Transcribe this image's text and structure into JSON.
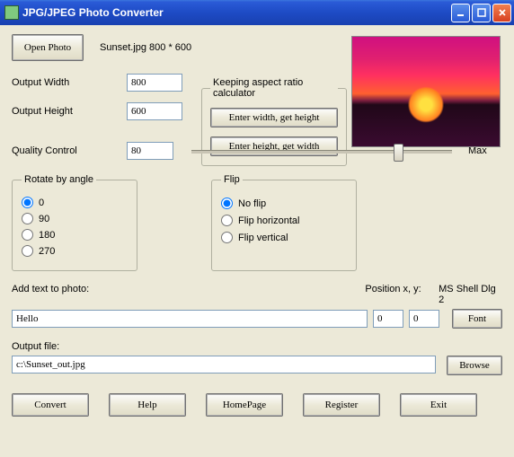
{
  "window": {
    "title": "JPG/JPEG Photo Converter"
  },
  "open_photo": {
    "button": "Open Photo",
    "filename": "Sunset.jpg 800 * 600"
  },
  "dimensions": {
    "width_label": "Output Width",
    "width_value": "800",
    "height_label": "Output Height",
    "height_value": "600"
  },
  "aspect": {
    "legend": "Keeping aspect ratio calculator",
    "btn_width": "Enter width, get height",
    "btn_height": "Enter height, get width"
  },
  "quality": {
    "label": "Quality Control",
    "value": "80",
    "max": "Max"
  },
  "rotate": {
    "legend": "Rotate by angle",
    "options": [
      "0",
      "90",
      "180",
      "270"
    ],
    "selected": "0"
  },
  "flip": {
    "legend": "Flip",
    "options": [
      "No flip",
      "Flip horizontal",
      "Flip vertical"
    ],
    "selected": "No flip"
  },
  "addtext": {
    "label": "Add text to photo:",
    "value": "Hello",
    "pos_label": "Position x, y:",
    "x": "0",
    "y": "0",
    "font_name": "MS Shell Dlg 2",
    "font_btn": "Font"
  },
  "output": {
    "label": "Output file:",
    "value": "c:\\Sunset_out.jpg",
    "browse": "Browse"
  },
  "bottom": {
    "convert": "Convert",
    "help": "Help",
    "homepage": "HomePage",
    "register": "Register",
    "exit": "Exit"
  }
}
